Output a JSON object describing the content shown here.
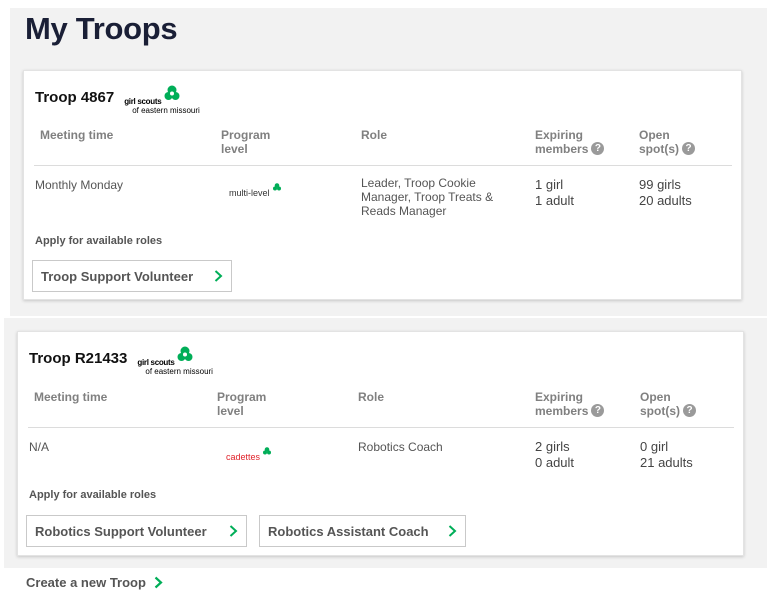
{
  "page": {
    "title": "My Troops",
    "create_troop_label": "Create a new Troop"
  },
  "colors": {
    "accent_green": "#00ae58",
    "cadettes_red": "#e0232b",
    "title_navy": "#1a1f36"
  },
  "columns": {
    "meeting_time": "Meeting time",
    "program_level_1": "Program",
    "program_level_2": "level",
    "role": "Role",
    "expiring_1": "Expiring",
    "expiring_2": "members",
    "open_1": "Open",
    "open_2": "spot(s)"
  },
  "icons": {
    "help": "?",
    "chevron": "chevron-right-icon",
    "logo": "trefoil-icon"
  },
  "council_logo": {
    "line1": "girl scouts",
    "line2": "of eastern missouri"
  },
  "apply_label": "Apply for available roles",
  "troops": [
    {
      "name": "Troop 4867",
      "meeting_time": "Monthly Monday",
      "program_level": "multi-level",
      "role": [
        "Leader, Troop Cookie",
        "Manager, Troop Treats &",
        "Reads Manager"
      ],
      "expiring": [
        "1 girl",
        "1 adult"
      ],
      "open": [
        "99 girls",
        "20 adults"
      ],
      "available_roles": [
        "Troop Support Volunteer"
      ]
    },
    {
      "name": "Troop R21433",
      "meeting_time": "N/A",
      "program_level": "cadettes",
      "role": [
        "Robotics Coach"
      ],
      "expiring": [
        "2 girls",
        "0 adult"
      ],
      "open": [
        "0 girl",
        "21 adults"
      ],
      "available_roles": [
        "Robotics Support Volunteer",
        "Robotics Assistant Coach"
      ]
    }
  ]
}
